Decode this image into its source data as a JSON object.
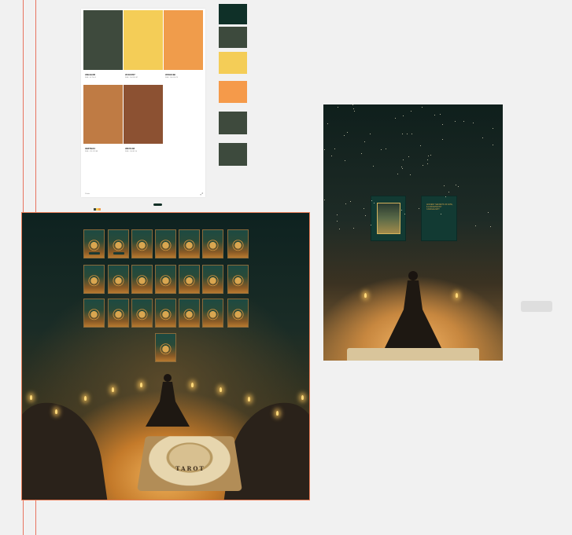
{
  "palette_card": {
    "swatches": [
      {
        "hex": "#3E4A3D",
        "sub": "RGB  ·  62 74 61",
        "color": "#3e4a3d"
      },
      {
        "hex": "#F4CD57",
        "sub": "RGB  ·  244 205 87",
        "color": "#f4cd57"
      },
      {
        "hex": "#F09C4B",
        "sub": "RGB  ·  240 156 75",
        "color": "#f09c4b"
      },
      {
        "hex": "#BF7B44",
        "sub": "RGB  ·  191 123 68",
        "color": "#bf7b44"
      },
      {
        "hex": "#8C5132",
        "sub": "RGB  ·  140 81 50",
        "color": "#8c5132"
      }
    ],
    "footer_left": "Palette",
    "footer_right": "⤢"
  },
  "side_swatches": [
    "#0f3028",
    "#3d4a3d",
    "#f4cd57",
    "#f59a4a",
    "#3e4a3d",
    "#3d4a3d"
  ],
  "main_scene": {
    "board_label": "TAROT",
    "accent": "#e57a55"
  },
  "right_scene": {
    "card_text": "ANCIENT SECRETS OF FATE, ILLUMINATED BY CANDLELIGHT"
  }
}
